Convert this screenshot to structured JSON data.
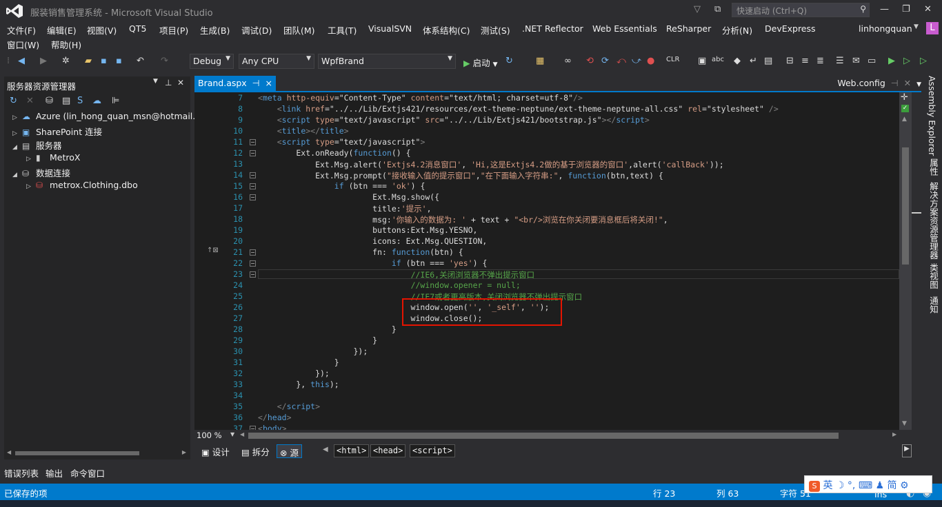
{
  "window": {
    "title": "服装销售管理系统 - Microsoft Visual Studio",
    "quick_launch_placeholder": "快速启动 (Ctrl+Q)",
    "user": "linhongquan",
    "user_initial": "L"
  },
  "menu": {
    "row1": [
      "文件(F)",
      "编辑(E)",
      "视图(V)",
      "QT5",
      "项目(P)",
      "生成(B)",
      "调试(D)",
      "团队(M)",
      "工具(T)",
      "VisualSVN",
      "体系结构(C)",
      "测试(S)",
      ".NET Reflector",
      "Web Essentials",
      "ReSharper",
      "分析(N)",
      "DevExpress"
    ],
    "row2": [
      "窗口(W)",
      "帮助(H)"
    ]
  },
  "toolbar": {
    "config": "Debug",
    "platform": "Any CPU",
    "project": "WpfBrand",
    "start_label": "启动"
  },
  "server_explorer": {
    "title": "服务器资源管理器",
    "nodes": [
      {
        "label": "Azure (lin_hong_quan_msn@hotmail.c",
        "level": 0,
        "expander": "▷",
        "icon": "☁"
      },
      {
        "label": "SharePoint 连接",
        "level": 0,
        "expander": "▷",
        "icon": "▣"
      },
      {
        "label": "服务器",
        "level": 0,
        "expander": "◢",
        "icon": "▤"
      },
      {
        "label": "MetroX",
        "level": 1,
        "expander": "▷",
        "icon": "▮"
      },
      {
        "label": "数据连接",
        "level": 0,
        "expander": "◢",
        "icon": "⛁"
      },
      {
        "label": "metrox.Clothing.dbo",
        "level": 1,
        "expander": "▷",
        "icon": "⛁"
      }
    ]
  },
  "editor": {
    "active_tab": "Brand.aspx",
    "active_tab_pin": "⊣",
    "active_tab_close": "×",
    "other_tab": "Web.config",
    "zoom": "100 %",
    "current_line": 23,
    "lines": [
      {
        "n": "7",
        "fold": "",
        "html": "<span class='t'>&lt;</span><span class='k'>meta</span> <span class='s'>http-equiv</span>=\"Content-Type\" <span class='s'>content</span>=\"text/html; charset=utf-8\"<span class='t'>/&gt;</span>"
      },
      {
        "n": "8",
        "fold": "",
        "html": "    <span class='t'>&lt;</span><span class='k'>link</span> <span class='s'>href</span>=\"../../Lib/Extjs421/resources/ext-theme-neptune/ext-theme-neptune-all.css\" <span class='s'>rel</span>=\"stylesheet\" <span class='t'>/&gt;</span>"
      },
      {
        "n": "9",
        "fold": "",
        "html": "    <span class='t'>&lt;</span><span class='k'>script</span> <span class='s'>type</span>=\"text/javascript\" <span class='s'>src</span>=\"../../Lib/Extjs421/bootstrap.js\"<span class='t'>&gt;&lt;/</span><span class='k'>script</span><span class='t'>&gt;</span>"
      },
      {
        "n": "10",
        "fold": "",
        "html": "    <span class='t'>&lt;</span><span class='k'>title</span><span class='t'>&gt;&lt;/</span><span class='k'>title</span><span class='t'>&gt;</span>"
      },
      {
        "n": "11",
        "fold": "⊟",
        "html": "    <span class='t'>&lt;</span><span class='k'>script</span> <span class='s'>type</span>=\"text/javascript\"<span class='t'>&gt;</span>"
      },
      {
        "n": "12",
        "fold": "⊟",
        "html": "        Ext.onReady(<span class='k'>function</span>() {"
      },
      {
        "n": "13",
        "fold": "",
        "html": "            Ext.Msg.alert(<span class='s'>'Extjs4.2消息窗口'</span>, <span class='s'>'Hi,这是Extjs4.2做的基于浏览器的窗口'</span>,alert(<span class='s'>'callBack'</span>));"
      },
      {
        "n": "14",
        "fold": "⊟",
        "html": "            Ext.Msg.prompt(<span class='s'>\"接收输入值的提示窗口\"</span>,<span class='s'>\"在下面输入字符串:\"</span>, <span class='k'>function</span>(btn,text) {"
      },
      {
        "n": "15",
        "fold": "⊟",
        "html": "                <span class='k'>if</span> (btn === <span class='s'>'ok'</span>) {"
      },
      {
        "n": "16",
        "fold": "⊟",
        "html": "                        Ext.Msg.show({"
      },
      {
        "n": "17",
        "fold": "",
        "html": "                        title:<span class='s'>'提示'</span>,"
      },
      {
        "n": "18",
        "fold": "",
        "html": "                        msg:<span class='s'>'你输入的数据为: '</span> + text + <span class='s'>\"&lt;br/&gt;浏览在你关闭要消息框后将关闭!\"</span>,"
      },
      {
        "n": "19",
        "fold": "",
        "html": "                        buttons:Ext.Msg.YESNO,"
      },
      {
        "n": "20",
        "fold": "",
        "html": "                        icons: Ext.Msg.QUESTION,"
      },
      {
        "n": "21",
        "fold": "⊟",
        "html": "                        fn: <span class='k'>function</span>(btn) {"
      },
      {
        "n": "22",
        "fold": "⊟",
        "html": "                            <span class='k'>if</span> (btn === <span class='s'>'yes'</span>) {"
      },
      {
        "n": "23",
        "fold": "⊟",
        "html": "                                <span class='c'>//IE6,关闭浏览器不弹出提示窗口</span>"
      },
      {
        "n": "24",
        "fold": "",
        "html": "                                <span class='c'>//window.opener = null;</span>"
      },
      {
        "n": "25",
        "fold": "",
        "html": "                                <span class='c'>//IE7或者更高版本,关闭浏览器不弹出提示窗口</span>"
      },
      {
        "n": "26",
        "fold": "",
        "html": "                                window.open(<span class='s'>''</span>, <span class='s'>'_self'</span>, <span class='s'>''</span>);"
      },
      {
        "n": "27",
        "fold": "",
        "html": "                                window.close();"
      },
      {
        "n": "28",
        "fold": "",
        "html": "                            }"
      },
      {
        "n": "29",
        "fold": "",
        "html": "                        }"
      },
      {
        "n": "30",
        "fold": "",
        "html": "                    });"
      },
      {
        "n": "31",
        "fold": "",
        "html": "                }"
      },
      {
        "n": "32",
        "fold": "",
        "html": "            });"
      },
      {
        "n": "33",
        "fold": "",
        "html": "        }, <span class='k'>this</span>);"
      },
      {
        "n": "34",
        "fold": "",
        "html": ""
      },
      {
        "n": "35",
        "fold": "",
        "html": "    <span class='t'>&lt;/</span><span class='k'>script</span><span class='t'>&gt;</span>"
      },
      {
        "n": "36",
        "fold": "",
        "html": "<span class='t'>&lt;/</span><span class='k'>head</span><span class='t'>&gt;</span>"
      },
      {
        "n": "37",
        "fold": "⊟",
        "html": "<span class='t'>&lt;</span><span class='k'>body</span><span class='t'>&gt;</span>"
      }
    ]
  },
  "view_tabs": {
    "design": "设计",
    "split": "拆分",
    "source": "源"
  },
  "breadcrumbs": [
    "<html>",
    "<head>",
    "<script>"
  ],
  "right_panels": [
    "Assembly Explorer",
    "属性",
    "解决方案资源管理器",
    "类视图",
    "通知"
  ],
  "bottom_tabs": [
    "错误列表",
    "输出",
    "命令窗口"
  ],
  "status": {
    "message": "已保存的项",
    "line": "行 23",
    "col": "列 63",
    "char": "字符 51",
    "ins": "Ins"
  },
  "ime": {
    "label": "英",
    "mode": "简"
  },
  "colors": {
    "accent": "#007acc",
    "highlight_box": "#e51400",
    "background": "#2d2d30",
    "editor_bg": "#1e1e1e"
  }
}
